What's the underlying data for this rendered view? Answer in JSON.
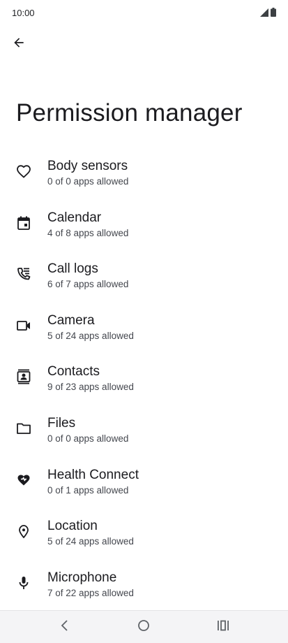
{
  "status_bar": {
    "time": "10:00"
  },
  "header": {
    "title": "Permission manager"
  },
  "permissions": [
    {
      "icon": "heart-icon",
      "title": "Body sensors",
      "subtitle": "0 of 0 apps allowed"
    },
    {
      "icon": "calendar-icon",
      "title": "Calendar",
      "subtitle": "4 of 8 apps allowed"
    },
    {
      "icon": "call-log-icon",
      "title": "Call logs",
      "subtitle": "6 of 7 apps allowed"
    },
    {
      "icon": "camera-icon",
      "title": "Camera",
      "subtitle": "5 of 24 apps allowed"
    },
    {
      "icon": "contacts-icon",
      "title": "Contacts",
      "subtitle": "9 of 23 apps allowed"
    },
    {
      "icon": "folder-icon",
      "title": "Files",
      "subtitle": "0 of 0 apps allowed"
    },
    {
      "icon": "health-connect-icon",
      "title": "Health Connect",
      "subtitle": "0 of 1 apps allowed"
    },
    {
      "icon": "location-pin-icon",
      "title": "Location",
      "subtitle": "5 of 24 apps allowed"
    },
    {
      "icon": "microphone-icon",
      "title": "Microphone",
      "subtitle": "7 of 22 apps allowed"
    }
  ],
  "nav_bar": {
    "icons": [
      "back-nav-icon",
      "home-nav-icon",
      "recents-nav-icon"
    ]
  },
  "colors": {
    "text": "#1b1b1f",
    "subtext": "#44474e",
    "icon": "#1b1b1f",
    "nav_background": "#f4f4f6"
  }
}
